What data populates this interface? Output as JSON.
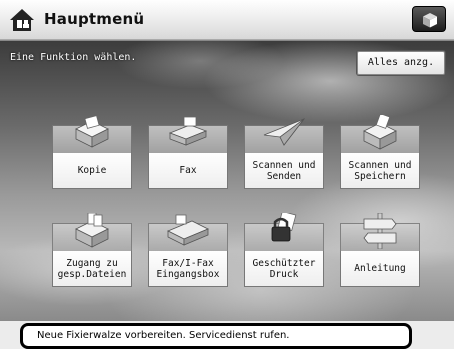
{
  "titlebar": {
    "title": "Hauptmenü",
    "home_icon": "home-icon",
    "corner_icon": "cube-icon"
  },
  "main": {
    "instruction": "Eine Funktion wählen.",
    "show_all_label": "Alles anzg.",
    "tiles": [
      {
        "label": "Kopie",
        "icon": "copy-icon"
      },
      {
        "label": "Fax",
        "icon": "fax-icon"
      },
      {
        "label": "Scannen und\nSenden",
        "icon": "scan-send-icon"
      },
      {
        "label": "Scannen und\nSpeichern",
        "icon": "scan-store-icon"
      },
      {
        "label": "Zugang zu\ngesp.Dateien",
        "icon": "stored-files-icon"
      },
      {
        "label": "Fax/I-Fax\nEingangsbox",
        "icon": "fax-inbox-icon"
      },
      {
        "label": "Geschützter\nDruck",
        "icon": "secure-print-icon"
      },
      {
        "label": "Anleitung",
        "icon": "signpost-icon"
      }
    ]
  },
  "status": {
    "message": "Neue Fixierwalze vorbereiten. Servicedienst rufen."
  }
}
